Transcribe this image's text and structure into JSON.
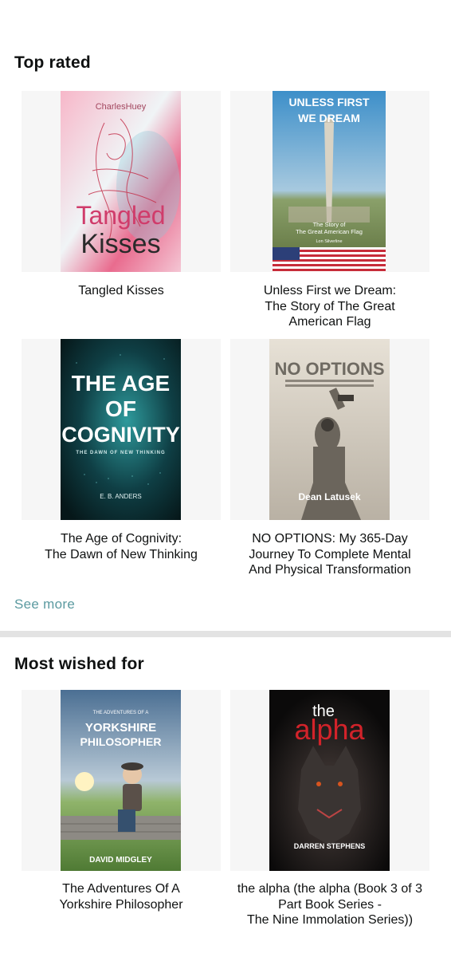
{
  "top_rated": {
    "title": "Top rated",
    "books": [
      {
        "title": "Tangled Kisses",
        "cover": {
          "author": "CharlesHuey",
          "line1": "Tangled",
          "line2": "Kisses"
        }
      },
      {
        "title": "Unless First we Dream:\nThe Story of The Great\nAmerican Flag",
        "cover": {
          "heading1": "UNLESS FIRST",
          "heading2": "WE DREAM",
          "sub1": "The Story of",
          "sub2": "The Great American Flag",
          "author": "Lon Silverline"
        }
      },
      {
        "title": "The Age of Cognivity:\nThe Dawn of New Thinking",
        "cover": {
          "line1": "THE AGE",
          "line2": "OF",
          "line3": "COGNIVITY",
          "sub": "THE DAWN OF NEW THINKING",
          "author": "E. B. ANDERS"
        }
      },
      {
        "title": "NO OPTIONS: My 365-Day\nJourney To Complete Mental\nAnd Physical Transformation",
        "cover": {
          "heading": "NO OPTIONS",
          "author": "Dean Latusek"
        }
      }
    ],
    "see_more": "See more"
  },
  "most_wished": {
    "title": "Most wished for",
    "books": [
      {
        "title": "The Adventures Of A\nYorkshire Philosopher",
        "cover": {
          "small": "THE ADVENTURES OF A",
          "line1": "YORKSHIRE",
          "line2": "PHILOSOPHER",
          "author": "DAVID MIDGLEY"
        }
      },
      {
        "title": "the alpha (the alpha (Book 3 of 3\nPart Book Series -\nThe Nine Immolation Series))",
        "cover": {
          "the": "the",
          "alpha": "alpha",
          "author": "DARREN STEPHENS"
        }
      }
    ]
  }
}
